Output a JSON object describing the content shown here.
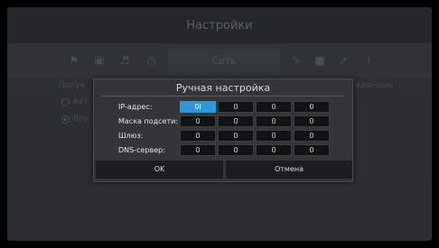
{
  "background": {
    "title": "Настройки",
    "network_tab_label": "Сеть",
    "receive_label": "Получ",
    "radio_auto_label": "Авт",
    "radio_manual_label": "Вру",
    "connection_label": "ключено"
  },
  "dialog": {
    "title": "Ручная настройка",
    "rows": [
      {
        "label": "IP-адрес:",
        "octets": [
          "0l",
          "0",
          "0",
          "0"
        ]
      },
      {
        "label": "Маска подсети:",
        "octets": [
          "0",
          "0",
          "0",
          "0"
        ]
      },
      {
        "label": "Шлюз:",
        "octets": [
          "0",
          "0",
          "0",
          "0"
        ]
      },
      {
        "label": "DNS-сервер:",
        "octets": [
          "0",
          "0",
          "0",
          "0"
        ]
      }
    ],
    "ok_label": "OK",
    "cancel_label": "Отмена",
    "focus_color": "#2f97d8"
  }
}
